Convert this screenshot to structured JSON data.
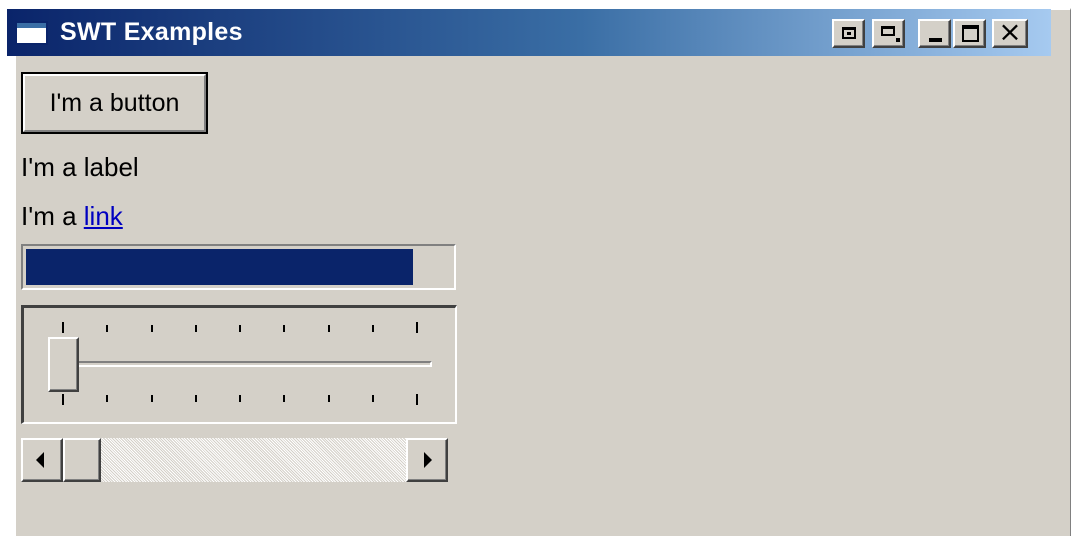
{
  "window": {
    "title": "SWT Examples",
    "title_buttons": [
      "restore-icon",
      "pin-icon",
      "minimize-icon",
      "maximize-icon",
      "close-icon"
    ],
    "close_glyph": "×"
  },
  "button": {
    "label": "I'm a button"
  },
  "label": {
    "text": "I'm a label"
  },
  "link": {
    "prefix": "I'm a ",
    "link_text": "link"
  },
  "progress": {
    "fraction": 0.91,
    "color": "#0a246a"
  },
  "slider": {
    "fraction": 0.0,
    "tick_count": 9
  },
  "scrollbar": {
    "fraction": 0.0
  },
  "colors": {
    "titlebar_start": "#0a246a",
    "titlebar_end": "#a6caf0",
    "face": "#d4d0c8",
    "link": "#0000c0"
  }
}
